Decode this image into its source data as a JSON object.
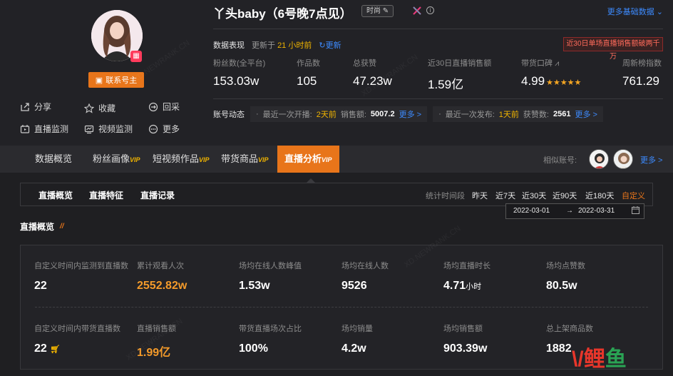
{
  "profile": {
    "contact_label": "联系号主",
    "badge_icon": "qr-badge-icon",
    "actions": [
      "分享",
      "收藏",
      "回采",
      "直播监测",
      "视频监测",
      "更多"
    ]
  },
  "header": {
    "title": "丫头baby（6号晚7点见）",
    "tag": "时尚",
    "more_base": "更多基础数据",
    "red_banner": "近30日单场直播销售额破两千万"
  },
  "performance": {
    "label": "数据表现",
    "updated_prefix": "更新于",
    "updated_value": "21 小时前",
    "refresh": "更新"
  },
  "stats": [
    {
      "label": "粉丝数(全平台)",
      "value": "153.03w"
    },
    {
      "label": "作品数",
      "value": "105"
    },
    {
      "label": "总获赞",
      "value": "47.23w"
    },
    {
      "label": "近30日直播销售额",
      "value": "1.59亿"
    },
    {
      "label": "带货口碑",
      "value": "4.99",
      "rating_stars": 5
    },
    {
      "label": "周新榜指数",
      "value": "761.29"
    }
  ],
  "dynamics": {
    "label": "账号动态",
    "live": {
      "text": "最近一次开播:",
      "ago": "2天前",
      "sales_label": "销售额:",
      "sales": "5007.2",
      "more": "更多 >"
    },
    "post": {
      "text": "最近一次发布:",
      "ago": "1天前",
      "likes_label": "获赞数:",
      "likes": "2561",
      "more": "更多 >"
    }
  },
  "tabs": [
    {
      "label": "数据概览",
      "vip": ""
    },
    {
      "label": "粉丝画像",
      "vip": "VIP"
    },
    {
      "label": "短视频作品",
      "vip": "VIP"
    },
    {
      "label": "带货商品",
      "vip": "VIP"
    },
    {
      "label": "直播分析",
      "vip": "VIP"
    }
  ],
  "similar": {
    "label": "相似账号:",
    "more": "更多 >"
  },
  "subtabs": [
    "直播概览",
    "直播特征",
    "直播记录"
  ],
  "range": {
    "label": "统计时间段",
    "options": [
      "昨天",
      "近7天",
      "近30天",
      "近90天",
      "近180天",
      "自定义"
    ],
    "active": "自定义",
    "start": "2022-03-01",
    "arrow": "→",
    "end": "2022-03-31"
  },
  "section": {
    "title": "直播概览",
    "mark": "//"
  },
  "metrics_row1": [
    {
      "label": "自定义时间内监测到直播数",
      "value": "22"
    },
    {
      "label": "累计观看人次",
      "value": "2552.82w",
      "highlight": true
    },
    {
      "label": "场均在线人数峰值",
      "value": "1.53w"
    },
    {
      "label": "场均在线人数",
      "value": "9526"
    },
    {
      "label": "场均直播时长",
      "value": "4.71",
      "unit": "小时"
    },
    {
      "label": "场均点赞数",
      "value": "80.5w"
    }
  ],
  "metrics_row2": [
    {
      "label": "自定义时间内带货直播数",
      "value": "22"
    },
    {
      "label": "直播销售额",
      "value": "1.99亿",
      "highlight": true
    },
    {
      "label": "带货直播场次占比",
      "value": "100%"
    },
    {
      "label": "场均销量",
      "value": "4.2w"
    },
    {
      "label": "场均销售额",
      "value": "903.39w"
    },
    {
      "label": "总上架商品数",
      "value": "1882"
    }
  ],
  "watermark": "XD.NEWRANK.CN",
  "logo": {
    "chars": [
      "\\",
      "/",
      "鲤",
      "鱼"
    ],
    "colors": [
      "#e8362b",
      "#e8362b",
      "#e8362b",
      "#2aa354"
    ]
  },
  "colors": {
    "accent": "#e8751a",
    "link": "#3d8bff",
    "gold": "#f0b400"
  }
}
